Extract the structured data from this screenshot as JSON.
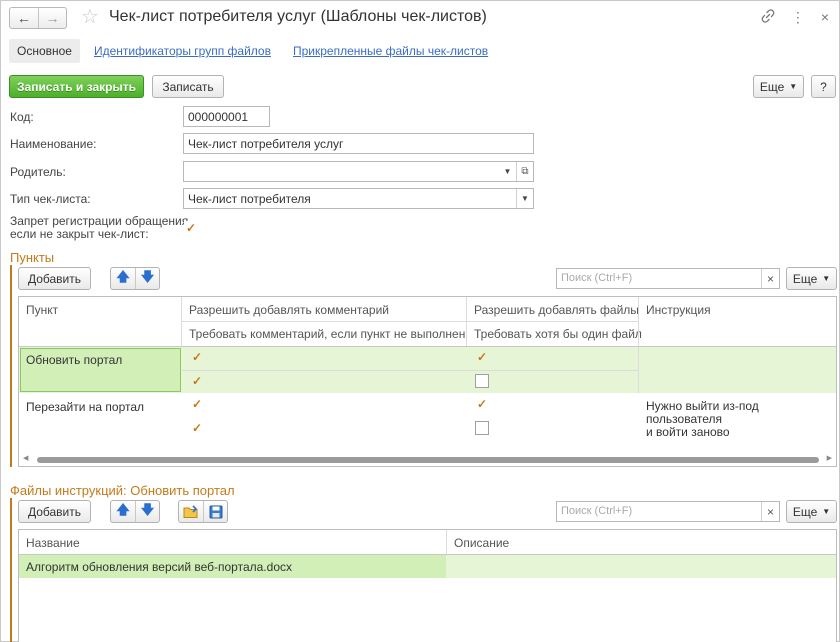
{
  "window": {
    "title": "Чек-лист потребителя услуг (Шаблоны чек-листов)",
    "back_icon": "←",
    "forward_icon": "→",
    "star_icon": "☆",
    "link_icon": "🔗",
    "menu_icon": "⋮",
    "close_icon": "×"
  },
  "tabs": [
    {
      "label": "Основное",
      "active": true
    },
    {
      "label": "Идентификаторы групп файлов",
      "active": false
    },
    {
      "label": "Прикрепленные файлы чек-листов",
      "active": false
    }
  ],
  "toolbar": {
    "save_close": "Записать и закрыть",
    "save": "Записать",
    "more": "Еще",
    "help": "?"
  },
  "form": {
    "code_label": "Код:",
    "code_value": "000000001",
    "name_label": "Наименование:",
    "name_value": "Чек-лист потребителя услуг",
    "parent_label": "Родитель:",
    "parent_value": "",
    "type_label": "Тип чек-листа:",
    "type_value": "Чек-лист потребителя",
    "forbid_label_1": "Запрет регистрации обращения,",
    "forbid_label_2": "если не закрыт чек-лист:",
    "forbid_checked": true
  },
  "points": {
    "section_title": "Пункты",
    "add": "Добавить",
    "search_placeholder": "Поиск (Ctrl+F)",
    "more": "Еще",
    "columns": {
      "point": "Пункт",
      "allow_comment": "Разрешить добавлять комментарий",
      "require_comment": "Требовать комментарий, если пункт не выполнен",
      "allow_files": "Разрешить добавлять файлы",
      "require_file": "Требовать хотя бы один файл",
      "instruction": "Инструкция"
    },
    "rows": [
      {
        "point": "Обновить портал",
        "allow_comment": true,
        "require_comment": true,
        "allow_files": true,
        "require_file": false,
        "instruction": ""
      },
      {
        "point": "Перезайти на портал",
        "allow_comment": true,
        "require_comment": true,
        "allow_files": true,
        "require_file": false,
        "instruction_1": "Нужно выйти из-под пользователя",
        "instruction_2": "и войти заново"
      }
    ]
  },
  "files": {
    "section_title": "Файлы инструкций: Обновить портал",
    "add": "Добавить",
    "search_placeholder": "Поиск (Ctrl+F)",
    "more": "Еще",
    "columns": {
      "name": "Название",
      "description": "Описание"
    },
    "rows": [
      {
        "name": "Алгоритм обновления версий веб-портала.docx",
        "description": ""
      }
    ]
  },
  "colors": {
    "accent": "#c47a1a",
    "primary_button": "#4caf2a",
    "selected_row": "#e6f5d6",
    "link": "#3b6cc2"
  }
}
